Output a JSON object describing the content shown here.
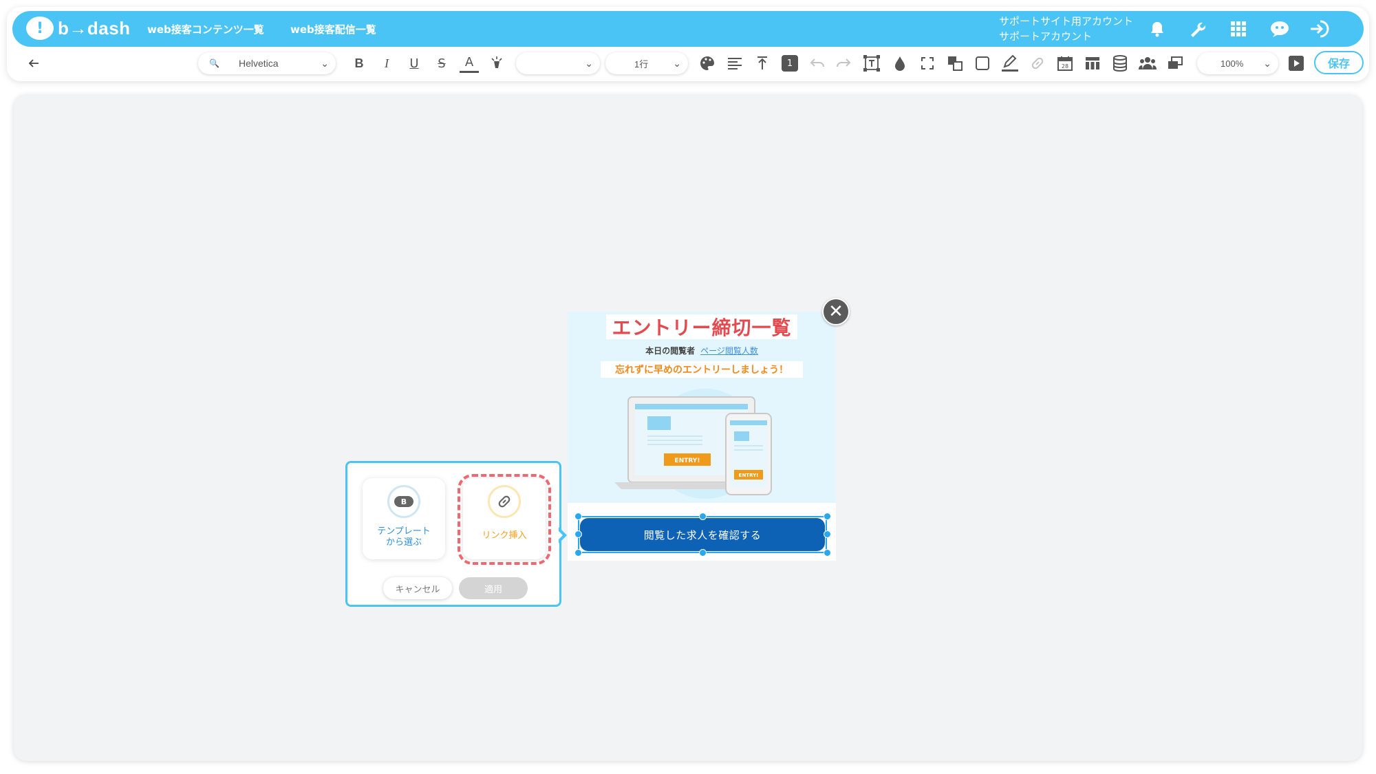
{
  "header": {
    "logo_text": "b→dash",
    "nav": [
      "web接客コンテンツ一覧",
      "web接客配信一覧"
    ],
    "account_line1": "サポートサイト用アカウント",
    "account_line2": "サポートアカウント"
  },
  "toolbar": {
    "font_family": "Helvetica",
    "line_height": "1行",
    "number_badge": "1",
    "calendar_day": "28",
    "zoom": "100%",
    "save_label": "保存"
  },
  "popup": {
    "title": "エントリー締切一覧",
    "viewer_label": "本日の閲覧者",
    "viewer_link": "ページ閲覧人数",
    "warning": "忘れずに早めのエントリーしましょう！",
    "entry_label_1": "ENTRY!",
    "entry_label_2": "ENTRY!",
    "cta": "閲覧した求人を確認する",
    "close_symbol": "✕"
  },
  "panel": {
    "template_badge": "B",
    "template_label_1": "テンプレート",
    "template_label_2": "から選ぶ",
    "link_label": "リンク挿入",
    "cancel": "キャンセル",
    "apply": "適用"
  },
  "colors": {
    "brand": "#4ac4f5",
    "cta": "#0d62b5",
    "title_red": "#e4494e",
    "warning_orange": "#f08a1c",
    "dashed_red": "#ee6870"
  }
}
